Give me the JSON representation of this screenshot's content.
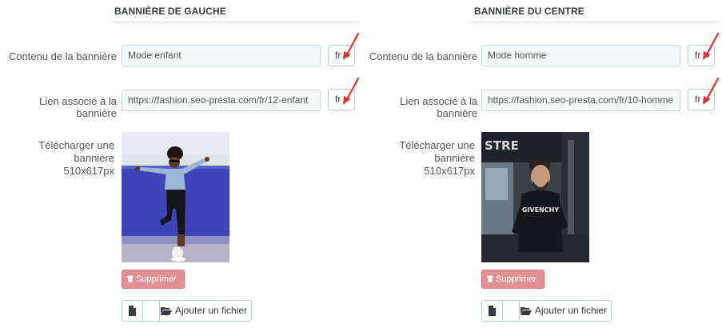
{
  "left": {
    "section_title": "BANNIÈRE DE GAUCHE",
    "content_label": "Contenu de la bannière",
    "content_value": "Mode enfant",
    "link_label": "Lien associé à la bannière",
    "link_value": "https://fashion.seo-presta.com/fr/12-enfant",
    "lang": "fr",
    "upload_label_line1": "Télécharger une bannière",
    "upload_label_line2": "510x617px",
    "delete_label": "Supprimer",
    "add_file_label": "Ajouter un fichier"
  },
  "center": {
    "section_title": "BANNIÈRE DU CENTRE",
    "content_label": "Contenu de la bannière",
    "content_value": "Mode homme",
    "link_label": "Lien associé à la bannière",
    "link_value": "https://fashion.seo-presta.com/fr/10-homme",
    "lang": "fr",
    "upload_label_line1": "Télécharger une bannière",
    "upload_label_line2": "510x617px",
    "delete_label": "Supprimer",
    "add_file_label": "Ajouter un fichier",
    "image_sign_text": "GIVENCHY"
  },
  "colors": {
    "annotation_arrow": "#e8302a",
    "delete_button": "#e48f94",
    "field_background": "#f5f8f9"
  },
  "icons": [
    "arrow-annotation-icon",
    "caret-down-icon",
    "trash-icon",
    "file-icon",
    "folder-open-icon"
  ]
}
